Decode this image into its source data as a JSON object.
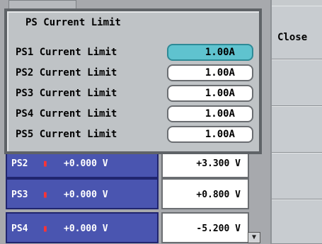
{
  "sidebar": {
    "close_label": "Close"
  },
  "dialog": {
    "title": "PS Current Limit",
    "rows": [
      {
        "label": "PS1 Current Limit",
        "value": "1.00A",
        "selected": true
      },
      {
        "label": "PS2 Current Limit",
        "value": "1.00A",
        "selected": false
      },
      {
        "label": "PS3 Current Limit",
        "value": "1.00A",
        "selected": false
      },
      {
        "label": "PS4 Current Limit",
        "value": "1.00A",
        "selected": false
      },
      {
        "label": "PS5 Current Limit",
        "value": "1.00A",
        "selected": false
      }
    ]
  },
  "table": {
    "rows": [
      {
        "name": "PS2",
        "indicator": "▮",
        "measured": "+0.000 V",
        "setpoint": "+3.300 V"
      },
      {
        "name": "PS3",
        "indicator": "▮",
        "measured": "+0.000 V",
        "setpoint": "+0.800 V"
      },
      {
        "name": "PS4",
        "indicator": "▮",
        "measured": "+0.000 V",
        "setpoint": "-5.200 V"
      }
    ]
  },
  "scroll": {
    "down_icon": "▼"
  }
}
